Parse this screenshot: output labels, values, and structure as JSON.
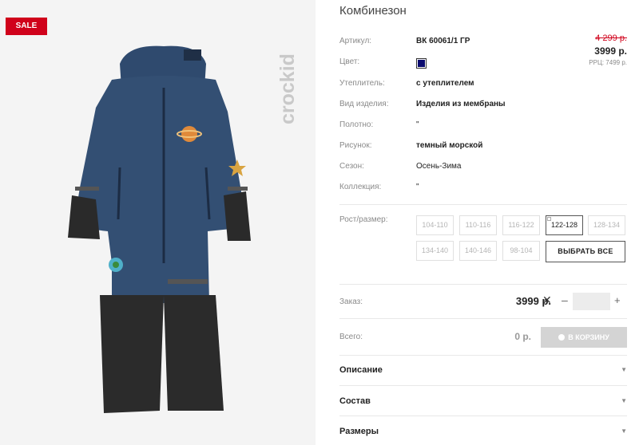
{
  "badge": {
    "sale": "SALE"
  },
  "brand": {
    "logo_text": "crockid"
  },
  "product": {
    "title": "Комбинезон",
    "rows": [
      {
        "label": "Артикул:",
        "value": "ВК 60061/1 ГР",
        "bold": true
      },
      {
        "label": "Цвет:",
        "value": "",
        "swatch": "#0a0a6e"
      },
      {
        "label": "Утеплитель:",
        "value": "с утеплителем",
        "bold": true
      },
      {
        "label": "Вид изделия:",
        "value": "Изделия из мембраны",
        "bold": true
      },
      {
        "label": "Полотно:",
        "value": "\"",
        "bold": false
      },
      {
        "label": "Рисунок:",
        "value": "темный морской",
        "bold": true
      },
      {
        "label": "Сезон:",
        "value": "Осень-Зима",
        "bold": false
      },
      {
        "label": "Коллекция:",
        "value": "\"",
        "bold": false
      }
    ]
  },
  "price": {
    "old": "4 299 р.",
    "new": "3999 р.",
    "rrp": "РРЦ: 7499 р."
  },
  "sizes": {
    "label": "Рост/размер:",
    "options": [
      "104-110",
      "110-116",
      "116-122",
      "122-128",
      "128-134",
      "134-140",
      "140-146",
      "98-104"
    ],
    "selected": "122-128",
    "select_all": "ВЫБРАТЬ ВСЕ"
  },
  "order": {
    "label": "Заказ:",
    "price": "3999 р.",
    "times": "✕",
    "minus": "–",
    "plus": "+",
    "qty": ""
  },
  "total": {
    "label": "Всего:",
    "value": "0 р.",
    "cart_button": "В КОРЗИНУ"
  },
  "accordion": [
    {
      "label": "Описание"
    },
    {
      "label": "Состав"
    },
    {
      "label": "Размеры"
    }
  ],
  "colors": {
    "sale": "#d0021b",
    "accent_dark": "#222222",
    "cart_disabled": "#d4d4d4"
  }
}
